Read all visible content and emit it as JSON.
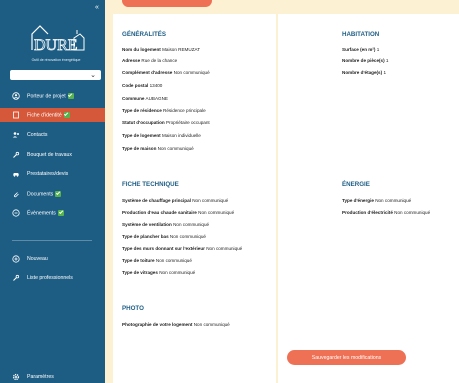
{
  "sidebar": {
    "logo_text": "DURE",
    "logo_sub": "Outil de rénovation énergétique",
    "collapse_label": "«",
    "select_value": "",
    "items": [
      {
        "label": "Porteur de projet",
        "icon": "user-circle-icon",
        "check": true
      },
      {
        "label": "Fiche d'identité",
        "icon": "document-icon",
        "check": true,
        "active": true
      },
      {
        "label": "Contacts",
        "icon": "contacts-icon",
        "check": false
      },
      {
        "label": "Bouquet de travaux",
        "icon": "wrench-icon",
        "check": false
      },
      {
        "label": "Prestataires/devis",
        "icon": "car-icon",
        "check": false
      },
      {
        "label": "Documents",
        "icon": "paperclip-icon",
        "check": true
      },
      {
        "label": "Évènements",
        "icon": "calendar-icon",
        "check": true
      },
      {
        "label": "Nouveau",
        "icon": "plus-circle-icon",
        "check": false
      },
      {
        "label": "Liste professionnels",
        "icon": "wrench-icon",
        "check": false
      },
      {
        "label": "Paramètres",
        "icon": "gear-icon",
        "check": false
      }
    ]
  },
  "general": {
    "title": "GÉNÉRALITÉS",
    "rows": [
      {
        "k": "Nom du logement",
        "v": "Maison REMUZAT"
      },
      {
        "k": "Adresse",
        "v": "Rue de la chance"
      },
      {
        "k": "Complément d'adresse",
        "v": "Non communiqué"
      },
      {
        "k": "Code postal",
        "v": "13400"
      },
      {
        "k": "Commune",
        "v": "AUBAGNE"
      },
      {
        "k": "Type de résidence",
        "v": "Résidence principale"
      },
      {
        "k": "Statut d'occupation",
        "v": "Propriétaire occupant"
      },
      {
        "k": "Type de logement",
        "v": "Maison individuelle"
      },
      {
        "k": "Type de maison",
        "v": "Non communiqué"
      }
    ]
  },
  "habitation": {
    "title": "HABITATION",
    "rows": [
      {
        "k": "Surface (en m²)",
        "v": "1"
      },
      {
        "k": "Nombre de pièce(s)",
        "v": "1"
      },
      {
        "k": "Nombre d'étage(s)",
        "v": "1"
      }
    ]
  },
  "technique": {
    "title": "FICHE TECHNIQUE",
    "rows": [
      {
        "k": "Système de chauffage principal",
        "v": "Non communiqué"
      },
      {
        "k": "Production d'eau chaude sanitaire",
        "v": "Non communiqué"
      },
      {
        "k": "Système de ventilation",
        "v": "Non communiqué"
      },
      {
        "k": "Type de plancher bas",
        "v": "Non communiqué"
      },
      {
        "k": "Type des murs donnant sur l'extérieur",
        "v": "Non communiqué"
      },
      {
        "k": "Type de toiture",
        "v": "Non communiqué"
      },
      {
        "k": "Type de vitrages",
        "v": "Non communiqué"
      }
    ]
  },
  "energie": {
    "title": "ÉNERGIE",
    "rows": [
      {
        "k": "Type d'énergie",
        "v": "Non communiqué"
      },
      {
        "k": "Production d'électricité",
        "v": "Non communiqué"
      }
    ]
  },
  "photo": {
    "title": "PHOTO",
    "rows": [
      {
        "k": "Photographie de votre logement",
        "v": "Non communiqué"
      }
    ]
  },
  "actions": {
    "save_label": "Sauvegarder les modifications"
  },
  "colors": {
    "sidebar": "#1d5d84",
    "accent": "#ef7155",
    "active": "#d5583a",
    "background": "#fdf1d4",
    "check": "#56b34e"
  }
}
